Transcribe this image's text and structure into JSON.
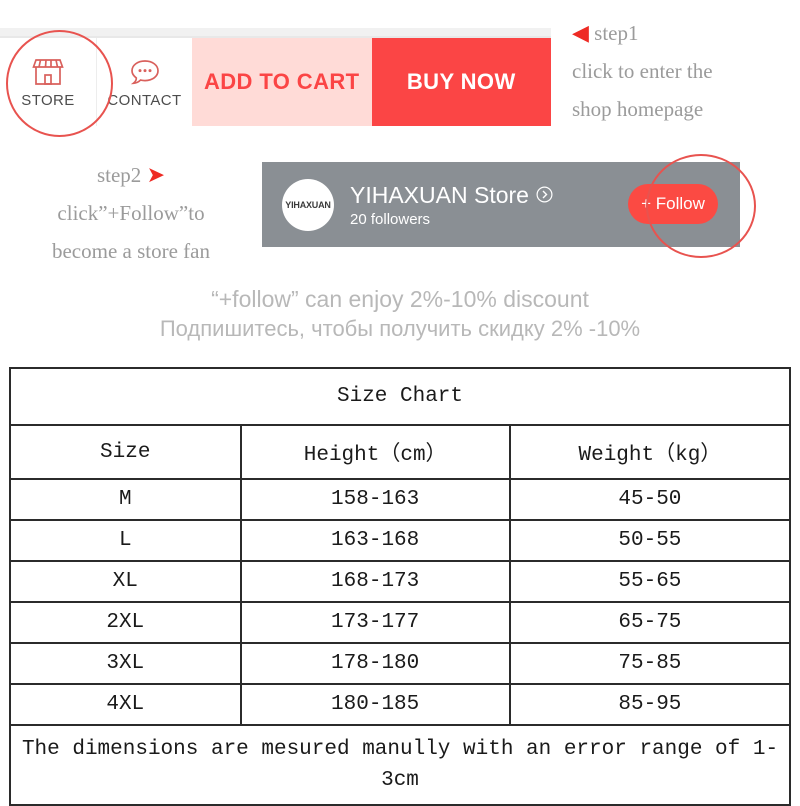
{
  "action_bar": {
    "store_button": {
      "label": "STORE",
      "icon": "storefront-icon"
    },
    "contact_button": {
      "label": "CONTACT",
      "icon": "speech-bubble-icon"
    },
    "add_to_cart_label": "ADD TO CART",
    "buy_now_label": "BUY NOW",
    "colors": {
      "add_to_cart_bg": "#ffdbd7",
      "add_to_cart_text": "#fb4545",
      "buy_now_bg": "#fb4545",
      "buy_now_text": "#ffffff",
      "icon_red": "#d9605c"
    }
  },
  "annotations": {
    "step1": {
      "arrow": "◀",
      "line1": "step1",
      "line2": "click to enter the",
      "line3": "shop homepage"
    },
    "step2": {
      "arrow": "➤",
      "line1": "step2",
      "line2": "click”+Follow”to",
      "line3": "become a store fan"
    },
    "highlight_color": "#e8534f",
    "arrow_color": "#ee2b24"
  },
  "store_banner": {
    "avatar_text": "YIHAXUAN",
    "store_name": "YIHAXUAN Store",
    "store_arrow_icon": "chevron-right-circle-icon",
    "followers": "20 followers",
    "follow_button_label": "+ Follow",
    "background_color": "#8a8f94",
    "follow_button_color": "#fb4a43"
  },
  "discount": {
    "line_en": "“+follow”  can enjoy 2%-10% discount",
    "line_ru": "Подпишитесь, чтобы получить скидку 2% -10%",
    "color": "#b8b8b8"
  },
  "size_chart": {
    "title": "Size Chart",
    "columns": [
      "Size",
      "Height（cm）",
      "Weight（kg）"
    ],
    "rows": [
      {
        "size": "M",
        "height": "158-163",
        "weight": "45-50"
      },
      {
        "size": "L",
        "height": "163-168",
        "weight": "50-55"
      },
      {
        "size": "XL",
        "height": "168-173",
        "weight": "55-65"
      },
      {
        "size": "2XL",
        "height": "173-177",
        "weight": "65-75"
      },
      {
        "size": "3XL",
        "height": "178-180",
        "weight": "75-85"
      },
      {
        "size": "4XL",
        "height": "180-185",
        "weight": "85-95"
      }
    ],
    "note": "The dimensions are mesured manully with an error range of 1-3cm"
  }
}
